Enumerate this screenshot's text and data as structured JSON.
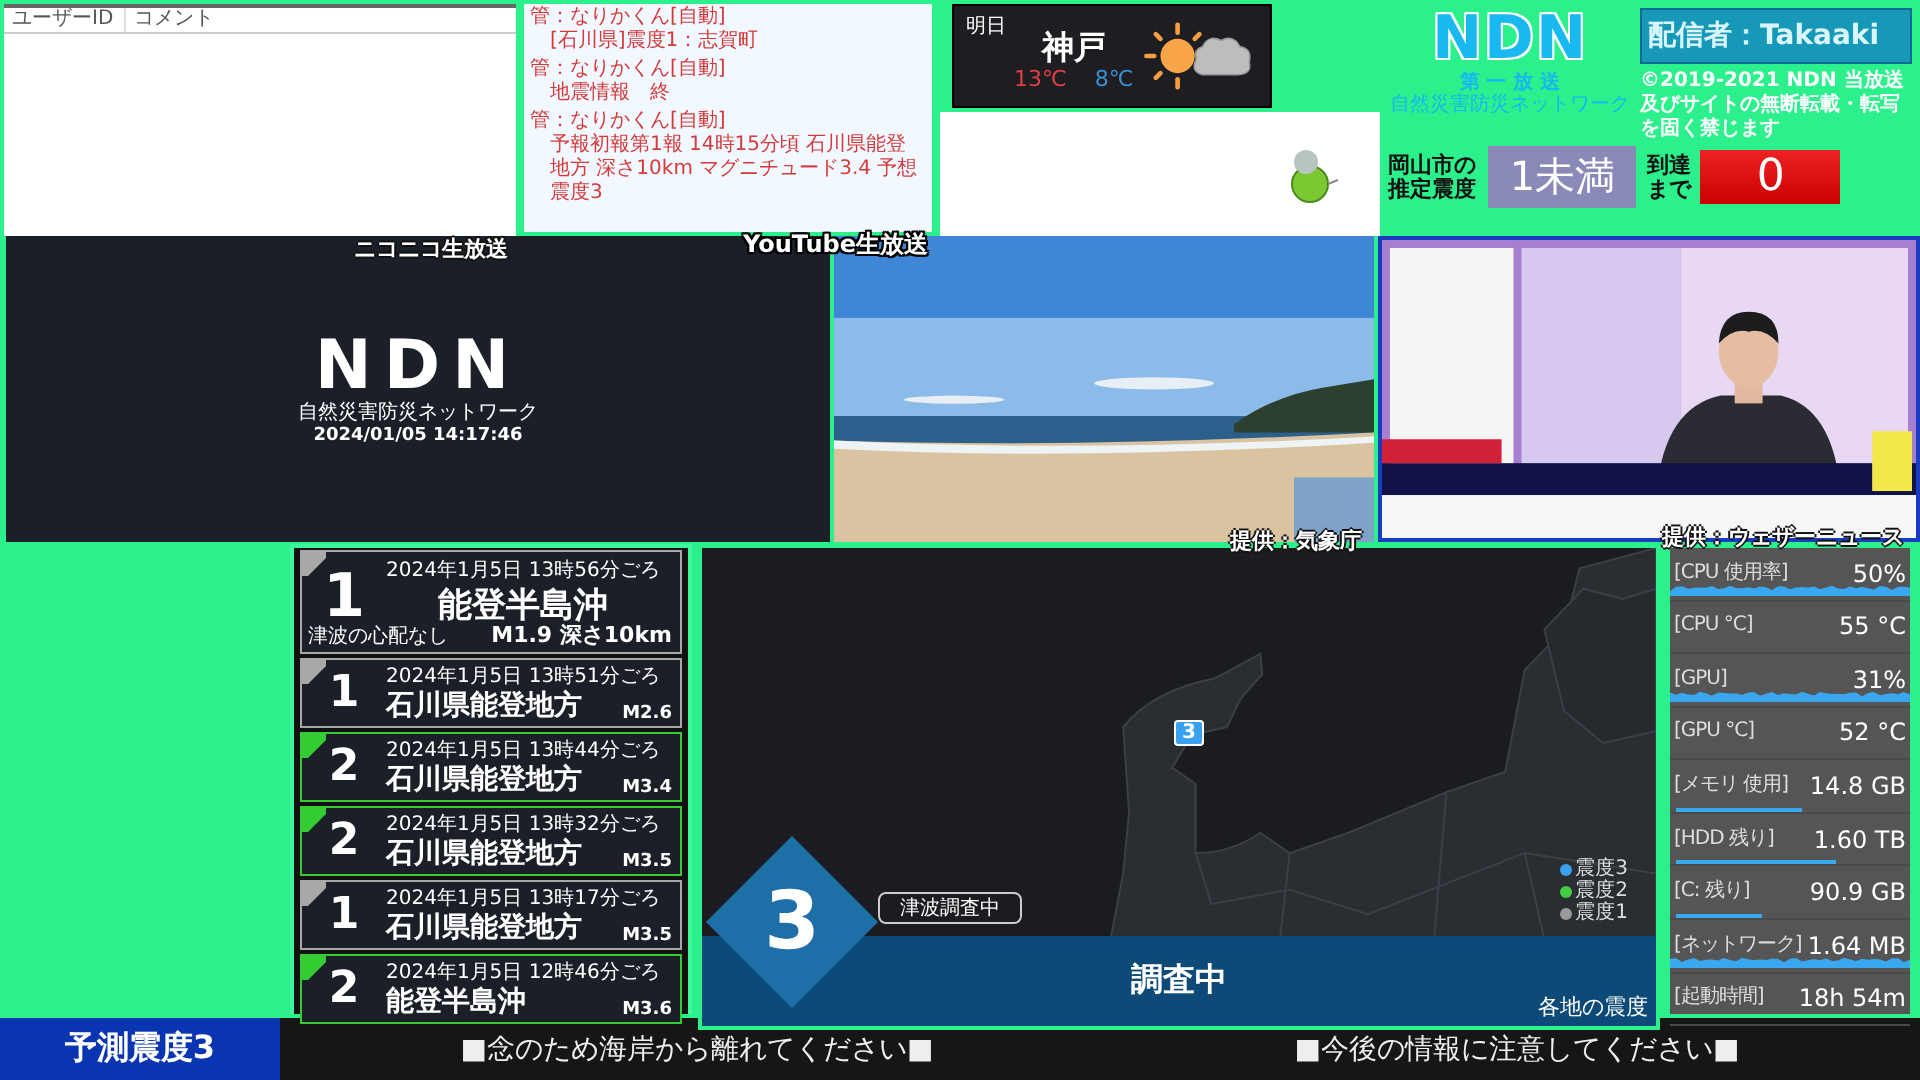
{
  "comment_panel": {
    "columns": [
      "ユーザーID",
      "コメント"
    ],
    "label": "ニコニコ生放送"
  },
  "chat_panel": {
    "label": "YouTube生放送",
    "messages": [
      {
        "user": "管：なりかくん[自動]",
        "text": "[石川県]震度1：志賀町"
      },
      {
        "user": "管：なりかくん[自動]",
        "text": "地震情報　終"
      },
      {
        "user": "管：なりかくん[自動]",
        "text": "予報初報第1報 14時15分頃 石川県能登地方 深さ10km マグニチュード3.4 予想震度3"
      }
    ]
  },
  "weather": {
    "day": "明日",
    "city": "神戸",
    "high": "13℃",
    "low": "8℃"
  },
  "logo": {
    "name": "NDN",
    "channel": "第 一 放 送",
    "network": "自然災害防災ネットワーク"
  },
  "broadcaster": "配信者：Takaaki",
  "copyright": "©2019-2021 NDN 当放送及びサイトの無断転載・転写を固く禁じます",
  "local": {
    "label": "岡山市の推定震度",
    "intensity": "1未満",
    "arrival_label": "到達まで",
    "countdown": "0"
  },
  "video": {
    "logo": "NDN",
    "subtitle": "自然災害防災ネットワーク",
    "timestamp": "2024/01/05 14:17:46"
  },
  "cameras": [
    {
      "kind": "beach",
      "credit": "提供：気象庁"
    },
    {
      "kind": "studio",
      "credit": "提供：ウェザーニュース"
    }
  ],
  "quakes": [
    {
      "kind": "latest",
      "intensity": "1",
      "color": "#a8a8a8",
      "time": "2024年1月5日 13時56分ごろ",
      "place": "能登半島沖",
      "magnitude": "M1.9 深さ10km",
      "note": "津波の心配なし"
    },
    {
      "kind": "past",
      "intensity": "1",
      "color": "#a8a8a8",
      "time": "2024年1月5日 13時51分ごろ",
      "place": "石川県能登地方",
      "magnitude": "M2.6"
    },
    {
      "kind": "past",
      "intensity": "2",
      "color": "#33cc33",
      "time": "2024年1月5日 13時44分ごろ",
      "place": "石川県能登地方",
      "magnitude": "M3.4"
    },
    {
      "kind": "past",
      "intensity": "2",
      "color": "#33cc33",
      "time": "2024年1月5日 13時32分ごろ",
      "place": "石川県能登地方",
      "magnitude": "M3.5"
    },
    {
      "kind": "past",
      "intensity": "1",
      "color": "#a8a8a8",
      "time": "2024年1月5日 13時17分ごろ",
      "place": "石川県能登地方",
      "magnitude": "M3.5"
    },
    {
      "kind": "past",
      "intensity": "2",
      "color": "#33cc33",
      "time": "2024年1月5日 12時46分ごろ",
      "place": "能登半島沖",
      "magnitude": "M3.6"
    }
  ],
  "map": {
    "marker": "3",
    "legend": [
      {
        "label": "震度3",
        "color": "#3aa0f0"
      },
      {
        "label": "震度2",
        "color": "#44cc44"
      },
      {
        "label": "震度1",
        "color": "#999999"
      }
    ],
    "max_intensity": "3",
    "tsunami": "津波調査中",
    "status": "調査中",
    "caption": "各地の震度"
  },
  "stats": [
    {
      "kind": "graph",
      "label": "[CPU 使用率]",
      "value": "50%"
    },
    {
      "kind": "plain",
      "label": "[CPU °C]",
      "value": "55 °C"
    },
    {
      "kind": "graph",
      "label": "[GPU]",
      "value": "31%"
    },
    {
      "kind": "plain",
      "label": "[GPU °C]",
      "value": "52 °C"
    },
    {
      "kind": "bar",
      "label": "[メモリ 使用]",
      "value": "14.8 GB",
      "level": 0.55
    },
    {
      "kind": "bar",
      "label": "[HDD 残り]",
      "value": "1.60 TB",
      "level": 0.7
    },
    {
      "kind": "bar",
      "label": "[C: 残り]",
      "value": "90.9 GB",
      "level": 0.38
    },
    {
      "kind": "graph",
      "label": "[ネットワーク]",
      "value": "1.64 MB"
    },
    {
      "kind": "plain",
      "label": "[起動時間]",
      "value": "18h 54m"
    }
  ],
  "ticker": {
    "forecast": "予測震度3",
    "messages": [
      "■念のため海岸から離れてください■",
      "■今後の情報に注意してください■"
    ]
  }
}
